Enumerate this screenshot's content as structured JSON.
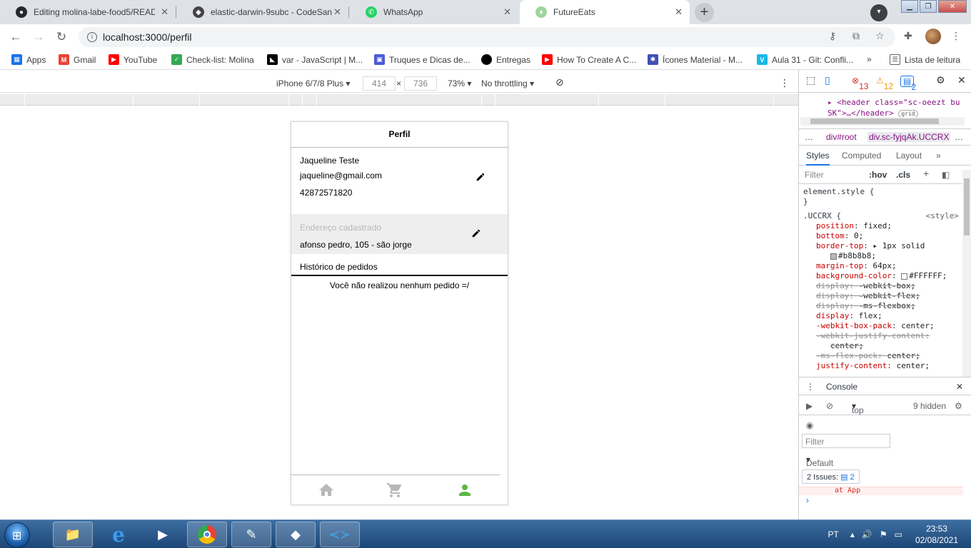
{
  "browser": {
    "tabs": [
      {
        "title": "Editing molina-labe-food5/READ",
        "icon": "github-icon",
        "color": "#24292e"
      },
      {
        "title": "elastic-darwin-9subc - CodeSand",
        "icon": "codesandbox-icon",
        "color": "#444"
      },
      {
        "title": "WhatsApp",
        "icon": "whatsapp-icon",
        "color": "#25d366"
      },
      {
        "title": "FutureEats",
        "icon": "app-icon",
        "color": "#9fd49d"
      }
    ],
    "url": "localhost:3000/perfil",
    "bookmarks": [
      {
        "label": "Apps",
        "color": "#1a73e8"
      },
      {
        "label": "Gmail",
        "color": "#ea4335"
      },
      {
        "label": "YouTube",
        "color": "#ff0000"
      },
      {
        "label": "Check-list: Molina",
        "color": "#34a853"
      },
      {
        "label": "var - JavaScript | M...",
        "color": "#000"
      },
      {
        "label": "Truques e Dicas de...",
        "color": "#4a5bd6"
      },
      {
        "label": "Entregas",
        "color": "#000"
      },
      {
        "label": "How To Create A C...",
        "color": "#ff0000"
      },
      {
        "label": "Ícones Material - M...",
        "color": "#3f51b5"
      },
      {
        "label": "Aula 31 - Git: Confli...",
        "color": "#1ab7ea"
      }
    ],
    "bookmarks_overflow": "»",
    "reading_list": "Lista de leitura"
  },
  "device_toolbar": {
    "device": "iPhone 6/7/8 Plus",
    "width": "414",
    "height": "736",
    "zoom": "73%",
    "throttling": "No throttling"
  },
  "page": {
    "title": "Perfil",
    "user": {
      "name": "Jaqueline Teste",
      "email": "jaqueline@gmail.com",
      "cpf": "42872571820"
    },
    "address_label": "Endereço cadastrado",
    "address": "afonso pedro, 105 - são jorge",
    "history_title": "Histórico de pedidos",
    "history_empty": "Você não realizou nenhum pedido =/",
    "accent_color": "#5cb646"
  },
  "devtools": {
    "errors": "13",
    "warnings": "12",
    "messages": "2",
    "dom_line1": "<header class=\"sc-oeezt bu",
    "dom_line2": "SK\">…</header>",
    "dom_badge": "grid",
    "crumbs": [
      "…",
      "div#root",
      "div.sc-fyjqAk.UCCRX",
      "…"
    ],
    "tabs": [
      "Styles",
      "Computed",
      "Layout",
      "»"
    ],
    "filter_placeholder": "Filter",
    "hov": ":hov",
    "cls": ".cls",
    "element_style": "element.style {",
    "close_brace": "}",
    "selector": ".UCCRX {",
    "source": "<style>",
    "declarations": [
      {
        "prop": "position",
        "value": "fixed;",
        "struck": false
      },
      {
        "prop": "bottom",
        "value": "0;",
        "struck": false
      },
      {
        "prop": "border-top",
        "value": "▸ 1px solid",
        "struck": false
      },
      {
        "prop": "",
        "value": "#b8b8b8;",
        "struck": false,
        "swatch": "#b8b8b8"
      },
      {
        "prop": "margin-top",
        "value": "64px;",
        "struck": false
      },
      {
        "prop": "background-color",
        "value": "#FFFFFF;",
        "struck": false,
        "swatch": "#ffffff"
      },
      {
        "prop": "display",
        "value": "-webkit-box;",
        "struck": true
      },
      {
        "prop": "display",
        "value": "-webkit-flex;",
        "struck": true
      },
      {
        "prop": "display",
        "value": "-ms-flexbox;",
        "struck": true
      },
      {
        "prop": "display",
        "value": "flex;",
        "struck": false
      },
      {
        "prop": "-webkit-box-pack",
        "value": "center;",
        "struck": false
      },
      {
        "prop": "-webkit-justify-content",
        "value": "",
        "struck": true
      },
      {
        "prop": "",
        "value": "center;",
        "struck": true
      },
      {
        "prop": "-ms-flex-pack",
        "value": "center;",
        "struck": true
      },
      {
        "prop": "justify-content",
        "value": "center;",
        "struck": false
      }
    ],
    "console_title": "Console",
    "context": "top",
    "hidden": "9 hidden",
    "console_filter": "Filter",
    "default_levels": "Default levels",
    "issues_label": "2 Issues:",
    "issues_count": "2",
    "error_tail": "at App",
    "prompt": "›"
  },
  "taskbar": {
    "language": "PT",
    "time": "23:53",
    "date": "02/08/2021"
  }
}
